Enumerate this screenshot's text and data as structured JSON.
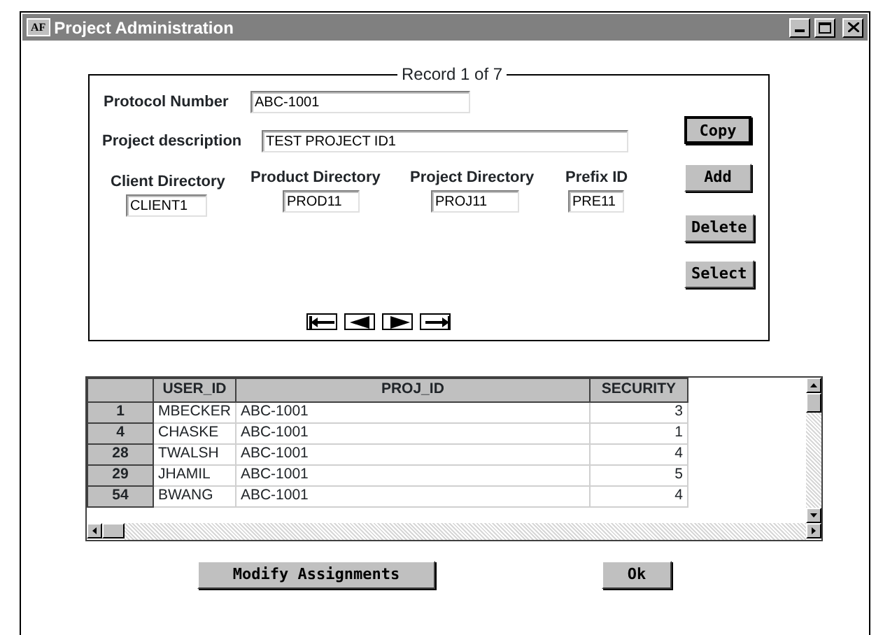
{
  "window": {
    "title": "Project Administration",
    "app_badge": "AF"
  },
  "record": {
    "legend": "Record 1 of 7"
  },
  "fields": [
    {
      "label": "Protocol Number",
      "value": "ABC-1001"
    },
    {
      "label": "Project description",
      "value": "TEST PROJECT ID1"
    }
  ],
  "directories": [
    {
      "label": "Client Directory",
      "value": "CLIENT1"
    },
    {
      "label": "Product Directory",
      "value": "PROD11"
    },
    {
      "label": "Project Directory",
      "value": "PROJ11"
    },
    {
      "label": "Prefix ID",
      "value": "PRE11"
    }
  ],
  "side_buttons": [
    {
      "label": "Copy",
      "focused": true
    },
    {
      "label": "Add",
      "focused": false
    },
    {
      "label": "Delete",
      "focused": false
    },
    {
      "label": "Select",
      "focused": false
    }
  ],
  "navigation": [
    {
      "kind": "first"
    },
    {
      "kind": "previous"
    },
    {
      "kind": "next"
    },
    {
      "kind": "last"
    }
  ],
  "table": {
    "columns": [
      "USER_ID",
      "PROJ_ID",
      "SECURITY"
    ],
    "rows": [
      {
        "row_header": "1",
        "cells": [
          "MBECKER",
          "ABC-1001",
          "3"
        ]
      },
      {
        "row_header": "4",
        "cells": [
          "CHASKE",
          "ABC-1001",
          "1"
        ]
      },
      {
        "row_header": "28",
        "cells": [
          "TWALSH",
          "ABC-1001",
          "4"
        ]
      },
      {
        "row_header": "29",
        "cells": [
          "JHAMIL",
          "ABC-1001",
          "5"
        ]
      },
      {
        "row_header": "54",
        "cells": [
          "BWANG",
          "ABC-1001",
          "4"
        ]
      }
    ]
  },
  "bottom_buttons": [
    "Modify Assignments",
    "Ok"
  ]
}
